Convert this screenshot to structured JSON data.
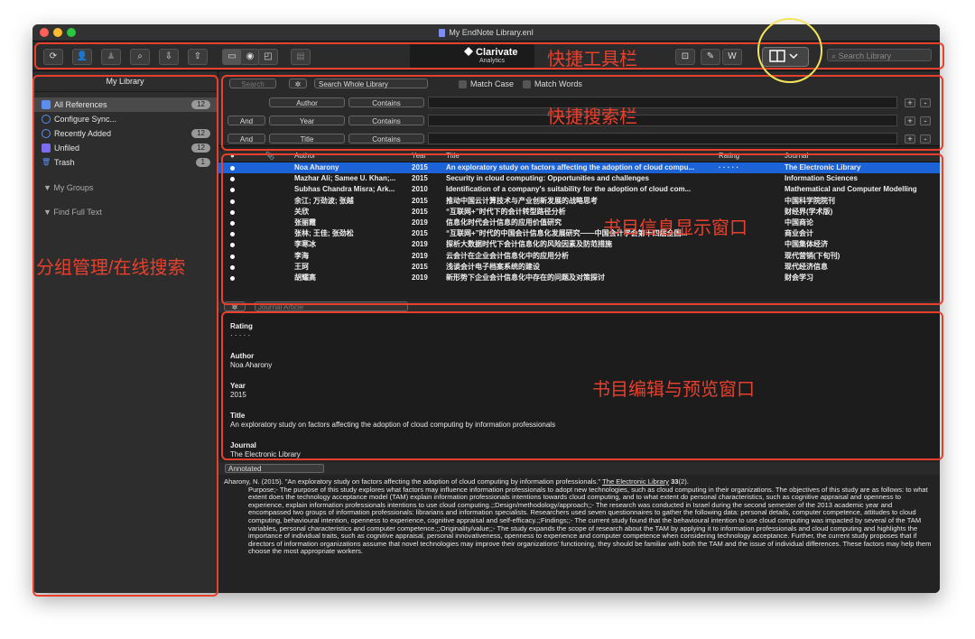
{
  "window": {
    "title": "My EndNote Library.enl"
  },
  "toolbar": {
    "brand_name": "Clarivate",
    "brand_sub": "Analytics",
    "search_placeholder": "Search Library"
  },
  "sidebar": {
    "header": "My Library",
    "items": [
      {
        "label": "All References",
        "count": "12"
      },
      {
        "label": "Configure Sync...",
        "count": ""
      },
      {
        "label": "Recently Added",
        "count": "12"
      },
      {
        "label": "Unfiled",
        "count": "12"
      },
      {
        "label": "Trash",
        "count": "1"
      }
    ],
    "groups": [
      "My Groups",
      "Find Full Text"
    ]
  },
  "search": {
    "search_button": "Search",
    "scope": "Search Whole Library",
    "match_case": "Match Case",
    "match_words": "Match Words",
    "rows": [
      {
        "op": "",
        "field": "Author",
        "cond": "Contains"
      },
      {
        "op": "And",
        "field": "Year",
        "cond": "Contains"
      },
      {
        "op": "And",
        "field": "Title",
        "cond": "Contains"
      }
    ]
  },
  "table": {
    "headers": {
      "author": "Author",
      "year": "Year",
      "title": "Title",
      "rating": "Rating",
      "journal": "Journal"
    },
    "rows": [
      {
        "author": "Noa Aharony",
        "year": "2015",
        "title": "An exploratory study on factors affecting the adoption of cloud compu...",
        "rating": "· · · · ·",
        "journal": "The Electronic Library"
      },
      {
        "author": "Mazhar Ali; Samee U. Khan;...",
        "year": "2015",
        "title": "Security in cloud computing: Opportunities and challenges",
        "rating": "",
        "journal": "Information Sciences"
      },
      {
        "author": "Subhas Chandra Misra; Ark...",
        "year": "2010",
        "title": "Identification of a company's suitability for the adoption of cloud com...",
        "rating": "",
        "journal": "Mathematical and Computer Modelling"
      },
      {
        "author": "余江; 万劲波; 张越",
        "year": "2015",
        "title": "推动中国云计算技术与产业创新发展的战略思考",
        "rating": "",
        "journal": "中国科学院院刊"
      },
      {
        "author": "关欣",
        "year": "2015",
        "title": "“互联网+”时代下的会计转型路径分析",
        "rating": "",
        "journal": "财经界(学术版)"
      },
      {
        "author": "张丽霞",
        "year": "2019",
        "title": "信息化时代会计信息的应用价值研究",
        "rating": "",
        "journal": "中国商论"
      },
      {
        "author": "张林; 王佳; 张劲松",
        "year": "2015",
        "title": "“互联网+”时代的中国会计信息化发展研究——中国会计学会第十四届全国...",
        "rating": "",
        "journal": "商业会计"
      },
      {
        "author": "李寒冰",
        "year": "2019",
        "title": "探析大数据时代下会计信息化的风险因素及防范措施",
        "rating": "",
        "journal": "中国集体经济"
      },
      {
        "author": "李海",
        "year": "2019",
        "title": "云会计在企业会计信息化中的应用分析",
        "rating": "",
        "journal": "现代营销(下旬刊)"
      },
      {
        "author": "王珂",
        "year": "2015",
        "title": "浅谈会计电子档案系统的建设",
        "rating": "",
        "journal": "现代经济信息"
      },
      {
        "author": "胡耀高",
        "year": "2019",
        "title": "新形势下企业会计信息化中存在的问题及对策探讨",
        "rating": "",
        "journal": "财会学习"
      }
    ]
  },
  "reference": {
    "type": "Journal Article",
    "rating_label": "Rating",
    "rating_value": "· · · · ·",
    "author_label": "Author",
    "author_value": "Noa Aharony",
    "year_label": "Year",
    "year_value": "2015",
    "title_label": "Title",
    "title_value": "An exploratory study on factors affecting the adoption of cloud computing by information professionals",
    "journal_label": "Journal",
    "journal_value": "The Electronic Library"
  },
  "annotated": {
    "style": "Annotated",
    "citation_prefix": "Aharony, N. (2015). \"An exploratory study on factors affecting the adoption of cloud computing by information professionals.\" ",
    "citation_journal": "The Electronic Library",
    "citation_vol": "33",
    "citation_suffix": "(2).",
    "abstract": "Purpose;- The purpose of this study explores what factors may influence information professionals to adopt new technologies, such as cloud computing in their organizations. The objectives of this study are as follows: to what extent does the technology acceptance model (TAM) explain information professionals intentions towards cloud computing, and to what extent do personal characteristics, such as cognitive appraisal and openness to experience, explain information professionals intentions to use cloud computing.;;Design/methodology/approach;;- The research was conducted in Israel during the second semester of the 2013 academic year and encompassed two groups of information professionals: librarians and information specialists. Researchers used seven questionnaires to gather the following data: personal details, computer competence, attitudes to cloud computing, behavioural intention, openness to experience, cognitive appraisal and self-efficacy.;;Findings;;- The current study found that the behavioural intention to use cloud computing was impacted by several of the TAM variables, personal characteristics and computer competence.;;Originality/value;;- The study expands the scope of research about the TAM by applying it to information professionals and cloud computing and highlights the importance of individual traits, such as cognitive appraisal, personal innovativeness, openness to experience and computer competence when considering technology acceptance. Further, the current study proposes that if directors of information organizations assume that novel technologies may improve their organizations' functioning, they should be familiar with both the TAM and the issue of individual differences. These factors may help them choose the most appropriate workers."
  },
  "annotations": {
    "toolbar_label": "快捷工具栏",
    "search_label": "快捷搜索栏",
    "list_label": "书目信息显示窗口",
    "edit_label": "书目编辑与预览窗口",
    "sidebar_label": "分组管理/在线搜索"
  },
  "colors": {
    "annotation_red": "#e8402d",
    "highlight_yellow": "#f3e45a",
    "selection_blue": "#1c63d8"
  }
}
